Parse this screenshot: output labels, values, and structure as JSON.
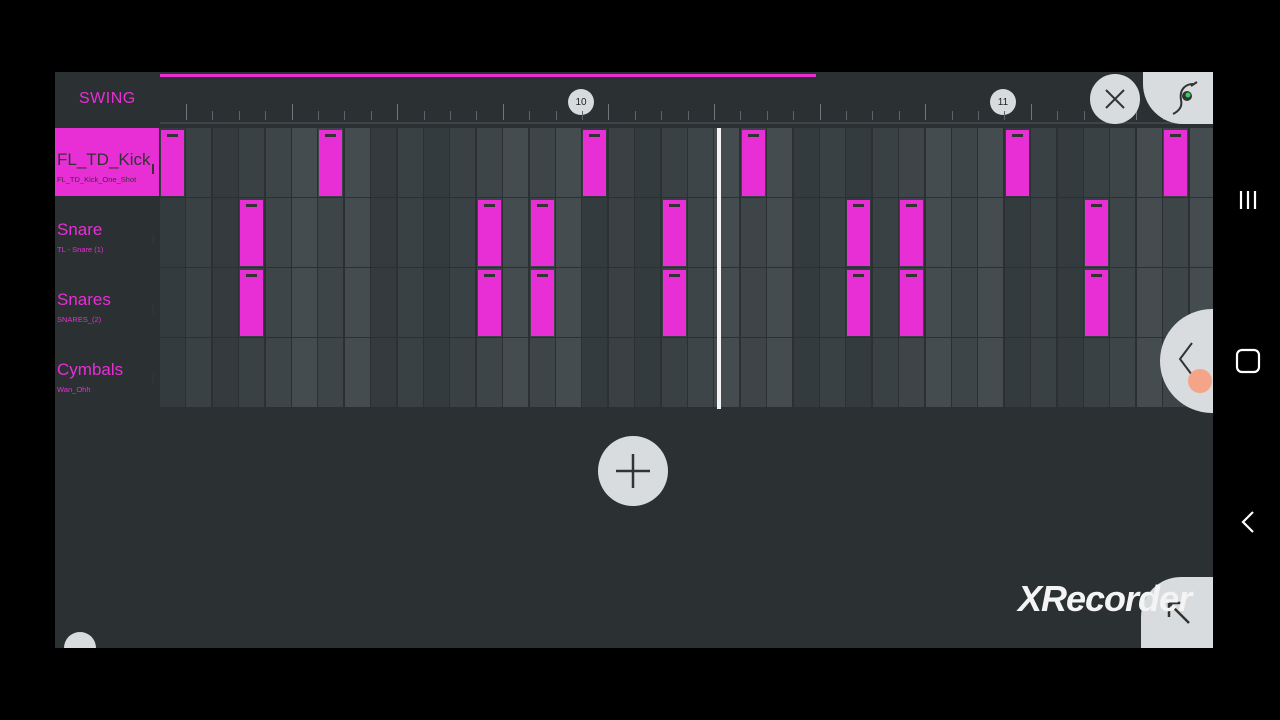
{
  "header": {
    "swing_label": "SWING"
  },
  "ruler": {
    "markers": [
      "10",
      "11"
    ]
  },
  "channels": [
    {
      "name": "FL_TD_Kick",
      "sample": "FL_TD_Kick_One_Shot",
      "selected": true,
      "steps": [
        1,
        0,
        0,
        0,
        0,
        0,
        1,
        0,
        0,
        0,
        0,
        0,
        0,
        0,
        0,
        0,
        1,
        0,
        0,
        0,
        0,
        0,
        1,
        0,
        0,
        0,
        0,
        0,
        0,
        0,
        0,
        0,
        1,
        0,
        0,
        0,
        0,
        0,
        1,
        0
      ]
    },
    {
      "name": "Snare",
      "sample": "TL - Snare (1)",
      "selected": false,
      "steps": [
        0,
        0,
        0,
        1,
        0,
        0,
        0,
        0,
        0,
        0,
        0,
        0,
        1,
        0,
        1,
        0,
        0,
        0,
        0,
        1,
        0,
        0,
        0,
        0,
        0,
        0,
        1,
        0,
        1,
        0,
        0,
        0,
        0,
        0,
        0,
        1,
        0,
        0,
        0,
        0
      ]
    },
    {
      "name": "Snares",
      "sample": "SNARES_(2)",
      "selected": false,
      "steps": [
        0,
        0,
        0,
        1,
        0,
        0,
        0,
        0,
        0,
        0,
        0,
        0,
        1,
        0,
        1,
        0,
        0,
        0,
        0,
        1,
        0,
        0,
        0,
        0,
        0,
        0,
        1,
        0,
        1,
        0,
        0,
        0,
        0,
        0,
        0,
        1,
        0,
        0,
        0,
        0
      ]
    },
    {
      "name": "Cymbals",
      "sample": "Wan_Ohh",
      "selected": false,
      "steps": [
        0,
        0,
        0,
        0,
        0,
        0,
        0,
        0,
        0,
        0,
        0,
        0,
        0,
        0,
        0,
        0,
        0,
        0,
        0,
        0,
        0,
        0,
        0,
        0,
        0,
        0,
        0,
        0,
        0,
        0,
        0,
        0,
        0,
        0,
        0,
        0,
        0,
        0,
        0,
        0
      ]
    }
  ],
  "watermark": "XRecorder",
  "icons": {
    "close": "close-icon",
    "add": "plus-icon",
    "menu": "fruit-logo-icon",
    "collapse": "chevron-left-icon",
    "nav_recent": "recent-apps-icon",
    "nav_home": "home-icon",
    "nav_back": "back-icon"
  },
  "colors": {
    "accent": "#e82fd5",
    "background": "#2b3033",
    "button": "#d9dcde"
  },
  "playback_position": 0.567
}
